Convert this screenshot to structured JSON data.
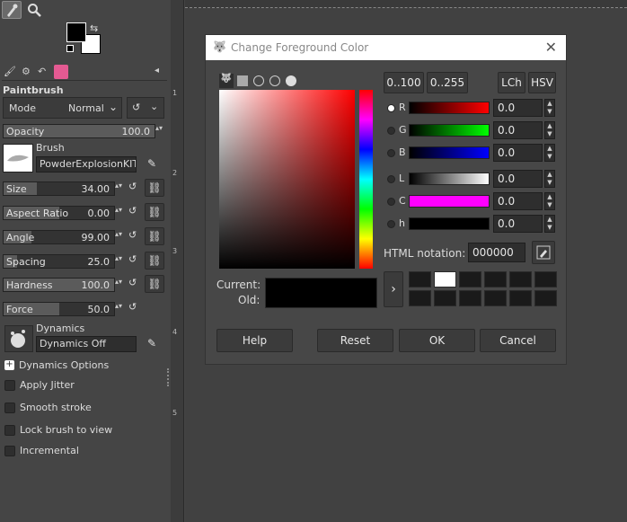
{
  "colors": {
    "fg": "#000000",
    "bg": "#ffffff"
  },
  "tool_options": {
    "title": "Paintbrush",
    "mode_label": "Mode",
    "mode_value": "Normal",
    "opacity": {
      "label": "Opacity",
      "value": "100.0",
      "fraction": 1.0
    },
    "brush": {
      "label": "Brush",
      "name": "PowderExplosionKIT.a"
    },
    "size": {
      "label": "Size",
      "value": "34.00",
      "fraction": 0.3
    },
    "aspect_ratio": {
      "label": "Aspect Ratio",
      "value": "0.00",
      "fraction": 0.5
    },
    "angle": {
      "label": "Angle",
      "value": "99.00",
      "fraction": 0.25
    },
    "spacing": {
      "label": "Spacing",
      "value": "25.0",
      "fraction": 0.12
    },
    "hardness": {
      "label": "Hardness",
      "value": "100.0",
      "fraction": 1.0
    },
    "force": {
      "label": "Force",
      "value": "50.0",
      "fraction": 0.5
    },
    "dynamics": {
      "label": "Dynamics",
      "value": "Dynamics Off"
    },
    "dynamics_options": "Dynamics Options",
    "apply_jitter": "Apply Jitter",
    "smooth_stroke": "Smooth stroke",
    "lock_brush": "Lock brush to view",
    "incremental": "Incremental"
  },
  "ruler_numbers": [
    "1",
    "2",
    "3",
    "4",
    "5"
  ],
  "dialog": {
    "title": "Change Foreground Color",
    "range_100": "0..100",
    "range_255": "0..255",
    "lch": "LCh",
    "hsv": "HSV",
    "channels": [
      {
        "label": "R",
        "value": "0.0",
        "selected": true
      },
      {
        "label": "G",
        "value": "0.0",
        "selected": false
      },
      {
        "label": "B",
        "value": "0.0",
        "selected": false
      },
      {
        "label": "L",
        "value": "0.0",
        "selected": false
      },
      {
        "label": "C",
        "value": "0.0",
        "selected": false
      },
      {
        "label": "h",
        "value": "0.0",
        "selected": false
      }
    ],
    "html_label": "HTML notation:",
    "html_value": "000000",
    "current_label": "Current:",
    "old_label": "Old:",
    "help": "Help",
    "reset": "Reset",
    "ok": "OK",
    "cancel": "Cancel"
  }
}
